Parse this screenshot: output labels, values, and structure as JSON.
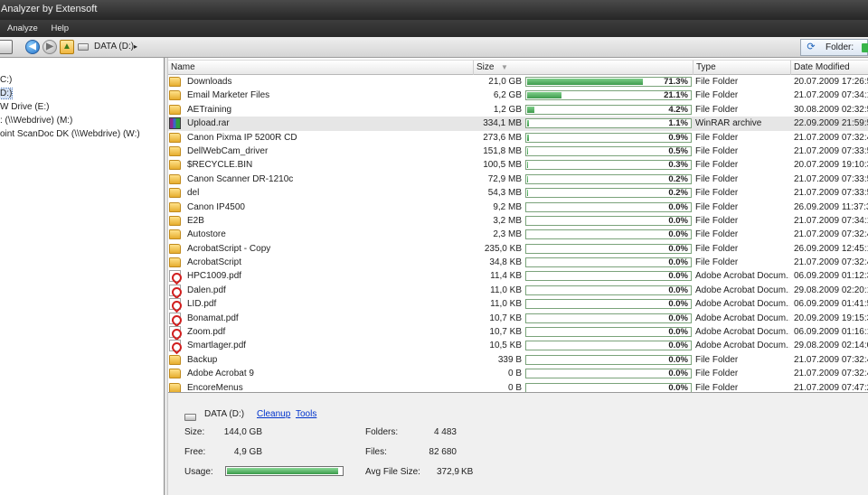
{
  "window": {
    "title": "Analyzer by Extensoft"
  },
  "menu": [
    "Analyze",
    "Help"
  ],
  "toolbar": {
    "address": "DATA (D:)",
    "address_arrow": "▸",
    "folder_label": "Folder:"
  },
  "tree": [
    {
      "label": "C:)",
      "selected": false
    },
    {
      "label": "D:)",
      "selected": true
    },
    {
      "label": "W Drive (E:)",
      "selected": false
    },
    {
      "label": ": (\\\\Webdrive) (M:)",
      "selected": false
    },
    {
      "label": "oint ScanDoc DK (\\\\Webdrive) (W:)",
      "selected": false
    }
  ],
  "list": {
    "columns": {
      "name": "Name",
      "size": "Size",
      "type": "Type",
      "date": "Date Modified"
    },
    "rows": [
      {
        "icon": "folder",
        "name": "Downloads",
        "size": "21,0 GB",
        "pct": "71.3%",
        "pct_value": 71.3,
        "type": "File Folder",
        "date": "20.07.2009 17:26:5"
      },
      {
        "icon": "folder",
        "name": "Email Marketer Files",
        "size": "6,2 GB",
        "pct": "21.1%",
        "pct_value": 21.1,
        "type": "File Folder",
        "date": "21.07.2009 07:34:1"
      },
      {
        "icon": "folder",
        "name": "AETraining",
        "size": "1,2 GB",
        "pct": "4.2%",
        "pct_value": 4.2,
        "type": "File Folder",
        "date": "30.08.2009 02:32:5"
      },
      {
        "icon": "rar",
        "name": "Upload.rar",
        "size": "334,1 MB",
        "pct": "1.1%",
        "pct_value": 1.1,
        "type": "WinRAR archive",
        "date": "22.09.2009 21:59:5",
        "highlight": true
      },
      {
        "icon": "folder",
        "name": "Canon Pixma IP 5200R CD",
        "size": "273,6 MB",
        "pct": "0.9%",
        "pct_value": 0.9,
        "type": "File Folder",
        "date": "21.07.2009 07:32:4"
      },
      {
        "icon": "folder",
        "name": "DellWebCam_driver",
        "size": "151,8 MB",
        "pct": "0.5%",
        "pct_value": 0.5,
        "type": "File Folder",
        "date": "21.07.2009 07:33:5"
      },
      {
        "icon": "folder",
        "name": "$RECYCLE.BIN",
        "size": "100,5 MB",
        "pct": "0.3%",
        "pct_value": 0.3,
        "type": "File Folder",
        "date": "20.07.2009 19:10:3"
      },
      {
        "icon": "folder",
        "name": "Canon Scanner DR-1210c",
        "size": "72,9 MB",
        "pct": "0.2%",
        "pct_value": 0.2,
        "type": "File Folder",
        "date": "21.07.2009 07:33:5"
      },
      {
        "icon": "folder",
        "name": "del",
        "size": "54,3 MB",
        "pct": "0.2%",
        "pct_value": 0.2,
        "type": "File Folder",
        "date": "21.07.2009 07:33:5"
      },
      {
        "icon": "folder",
        "name": "Canon IP4500",
        "size": "9,2 MB",
        "pct": "0.0%",
        "pct_value": 0.0,
        "type": "File Folder",
        "date": "26.09.2009 11:37:3"
      },
      {
        "icon": "folder",
        "name": "E2B",
        "size": "3,2 MB",
        "pct": "0.0%",
        "pct_value": 0.0,
        "type": "File Folder",
        "date": "21.07.2009 07:34:1"
      },
      {
        "icon": "folder",
        "name": "Autostore",
        "size": "2,3 MB",
        "pct": "0.0%",
        "pct_value": 0.0,
        "type": "File Folder",
        "date": "21.07.2009 07:32:4"
      },
      {
        "icon": "folder",
        "name": "AcrobatScript - Copy",
        "size": "235,0 KB",
        "pct": "0.0%",
        "pct_value": 0.0,
        "type": "File Folder",
        "date": "26.09.2009 12:45:1"
      },
      {
        "icon": "folder",
        "name": "AcrobatScript",
        "size": "34,8 KB",
        "pct": "0.0%",
        "pct_value": 0.0,
        "type": "File Folder",
        "date": "21.07.2009 07:32:4"
      },
      {
        "icon": "pdf",
        "name": "HPC1009.pdf",
        "size": "11,4 KB",
        "pct": "0.0%",
        "pct_value": 0.0,
        "type": "Adobe Acrobat Docum...",
        "date": "06.09.2009 01:12:3"
      },
      {
        "icon": "pdf",
        "name": "Dalen.pdf",
        "size": "11,0 KB",
        "pct": "0.0%",
        "pct_value": 0.0,
        "type": "Adobe Acrobat Docum...",
        "date": "29.08.2009 02:20:1"
      },
      {
        "icon": "pdf",
        "name": "LID.pdf",
        "size": "11,0 KB",
        "pct": "0.0%",
        "pct_value": 0.0,
        "type": "Adobe Acrobat Docum...",
        "date": "06.09.2009 01:41:5"
      },
      {
        "icon": "pdf",
        "name": "Bonamat.pdf",
        "size": "10,7 KB",
        "pct": "0.0%",
        "pct_value": 0.0,
        "type": "Adobe Acrobat Docum...",
        "date": "20.09.2009 19:15:3"
      },
      {
        "icon": "pdf",
        "name": "Zoom.pdf",
        "size": "10,7 KB",
        "pct": "0.0%",
        "pct_value": 0.0,
        "type": "Adobe Acrobat Docum...",
        "date": "06.09.2009 01:16:1"
      },
      {
        "icon": "pdf",
        "name": "Smartlager.pdf",
        "size": "10,5 KB",
        "pct": "0.0%",
        "pct_value": 0.0,
        "type": "Adobe Acrobat Docum...",
        "date": "29.08.2009 02:14:0"
      },
      {
        "icon": "folder",
        "name": "Backup",
        "size": "339 B",
        "pct": "0.0%",
        "pct_value": 0.0,
        "type": "File Folder",
        "date": "21.07.2009 07:32:4"
      },
      {
        "icon": "folder",
        "name": "Adobe Acrobat 9",
        "size": "0 B",
        "pct": "0.0%",
        "pct_value": 0.0,
        "type": "File Folder",
        "date": "21.07.2009 07:32:4"
      },
      {
        "icon": "folder",
        "name": "EncoreMenus",
        "size": "0 B",
        "pct": "0.0%",
        "pct_value": 0.0,
        "type": "File Folder",
        "date": "21.07.2009 07:47:2"
      }
    ]
  },
  "summary": {
    "drive": "DATA (D:)",
    "links": {
      "cleanup": "Cleanup",
      "tools": "Tools"
    },
    "size_label": "Size:",
    "size_value": "144,0 GB",
    "free_label": "Free:",
    "free_value": "4,9 GB",
    "usage_label": "Usage:",
    "usage_fraction": 0.966,
    "folders_label": "Folders:",
    "folders_value": "4 483",
    "files_label": "Files:",
    "files_value": "82 680",
    "avg_label": "Avg File Size:",
    "avg_value": "372,9",
    "avg_unit": "KB"
  },
  "colors": {
    "bar_fill": "#3e9a4d",
    "titlebar": "#262626",
    "link": "#0033cc"
  }
}
